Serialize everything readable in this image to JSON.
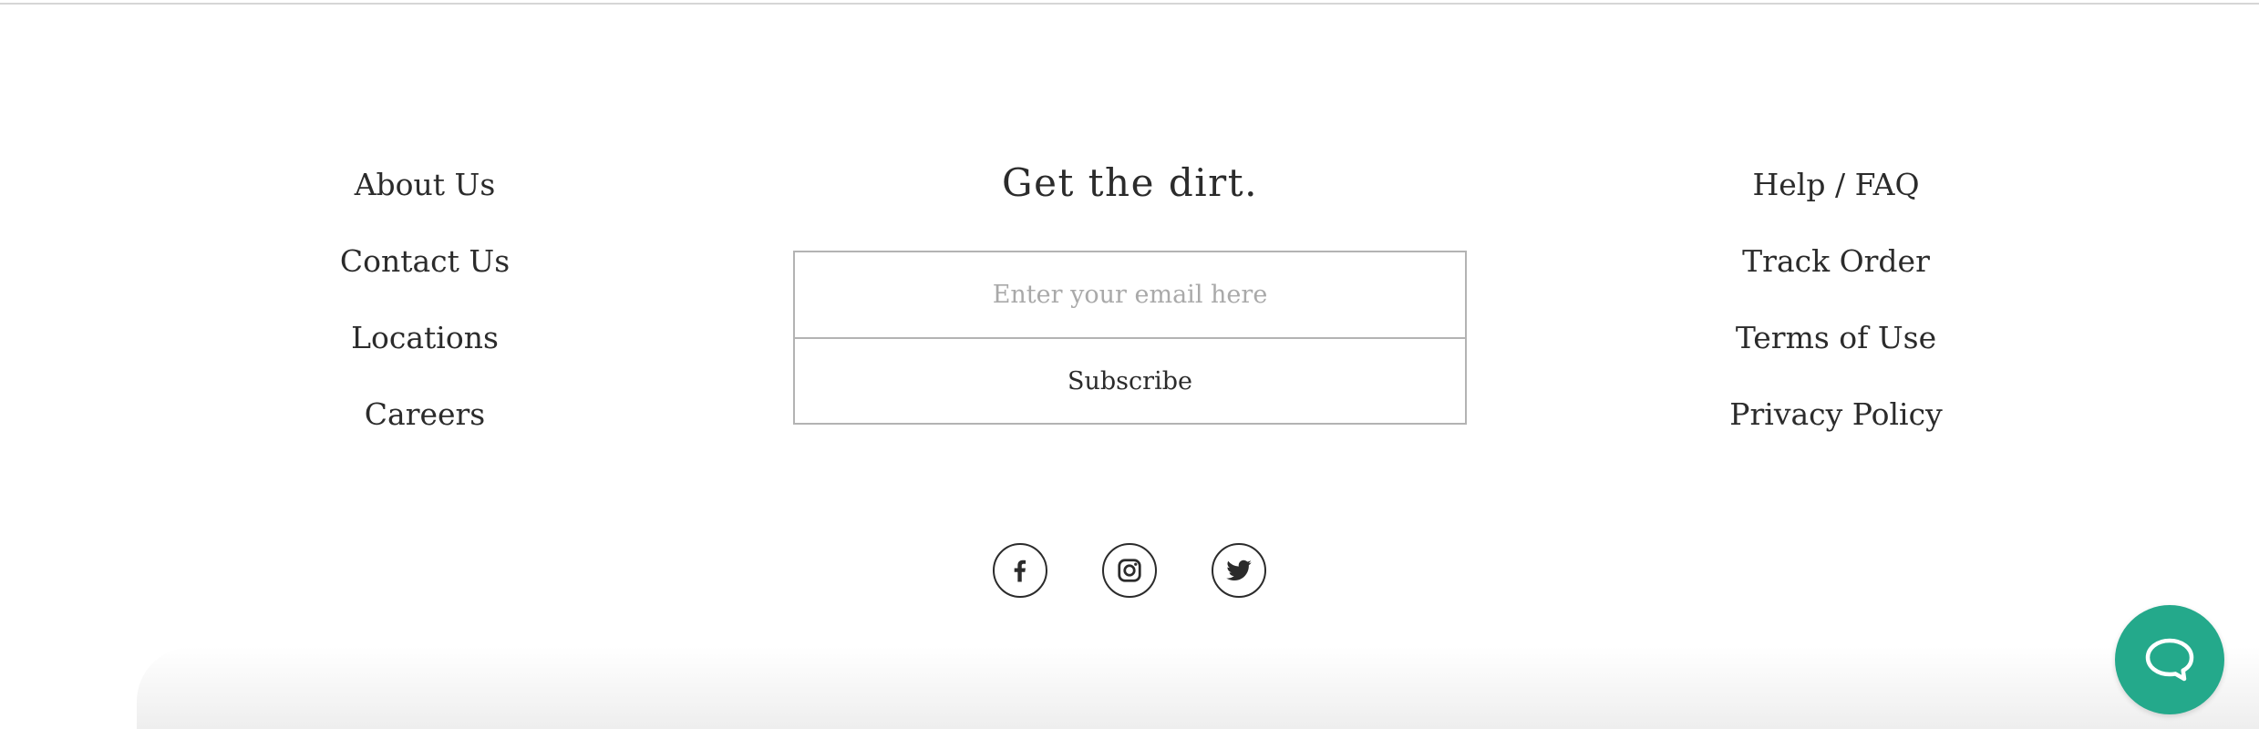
{
  "footer": {
    "left_links": [
      {
        "label": "About Us"
      },
      {
        "label": "Contact Us"
      },
      {
        "label": "Locations"
      },
      {
        "label": "Careers"
      }
    ],
    "right_links": [
      {
        "label": "Help / FAQ"
      },
      {
        "label": "Track Order"
      },
      {
        "label": "Terms of Use"
      },
      {
        "label": "Privacy Policy"
      }
    ],
    "newsletter": {
      "title": "Get the dirt.",
      "email_placeholder": "Enter your email here",
      "email_value": "",
      "subscribe_label": "Subscribe"
    },
    "social": [
      {
        "icon": "facebook-icon"
      },
      {
        "icon": "instagram-icon"
      },
      {
        "icon": "twitter-icon"
      }
    ]
  },
  "chat": {
    "icon": "chat-bubble-icon",
    "color": "#24a98b"
  },
  "colors": {
    "text": "#2b2b2b",
    "border": "#b3b3b3",
    "placeholder": "#a9a9a9"
  }
}
